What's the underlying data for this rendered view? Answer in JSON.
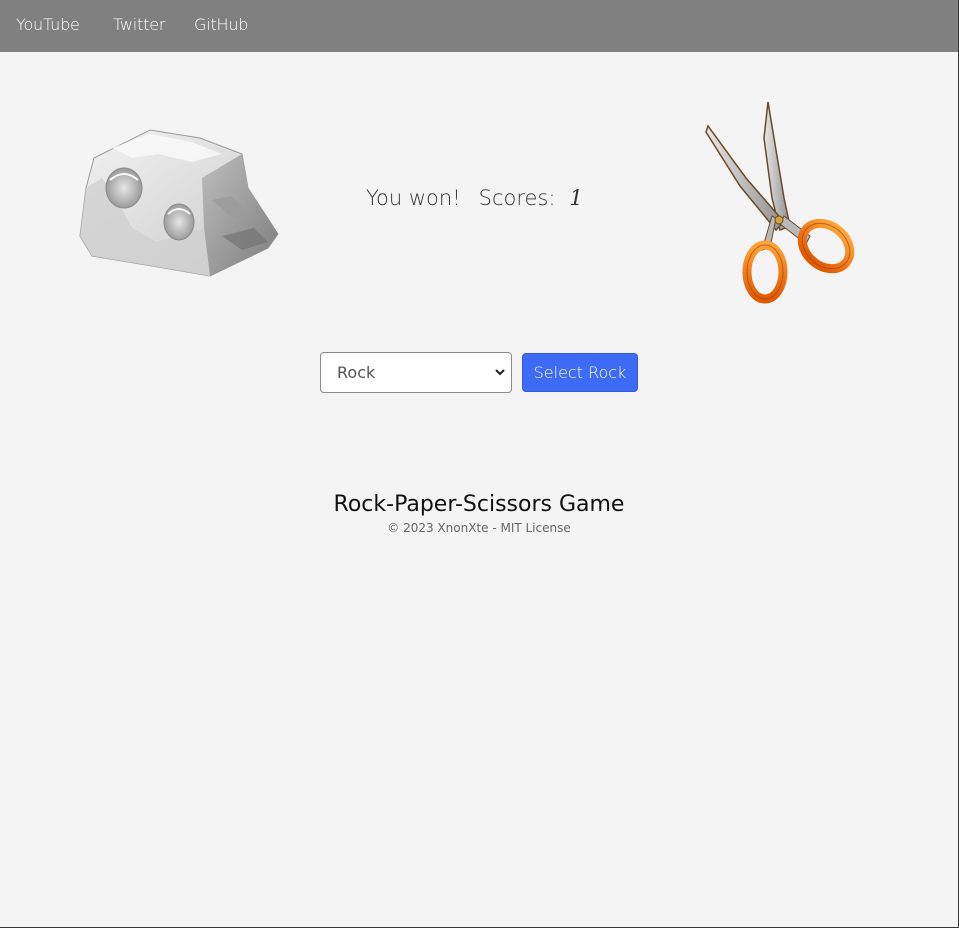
{
  "nav": {
    "links": [
      {
        "label": "YouTube"
      },
      {
        "label": "Twitter"
      },
      {
        "label": "GitHub"
      }
    ]
  },
  "game": {
    "player_choice_icon": "rock-image",
    "computer_choice_icon": "scissors-image",
    "result_text": "You won!",
    "scores_label": "Scores:",
    "score_value": "1"
  },
  "controls": {
    "select_value": "Rock",
    "select_options": [
      "Rock"
    ],
    "button_label": "Select Rock",
    "button_color": "#3d6bf5"
  },
  "footer": {
    "title": "Rock-Paper-Scissors Game",
    "copyright": "© 2023 XnonXte - MIT License"
  },
  "colors": {
    "navbar": "#808080",
    "background": "#f4f4f4"
  }
}
